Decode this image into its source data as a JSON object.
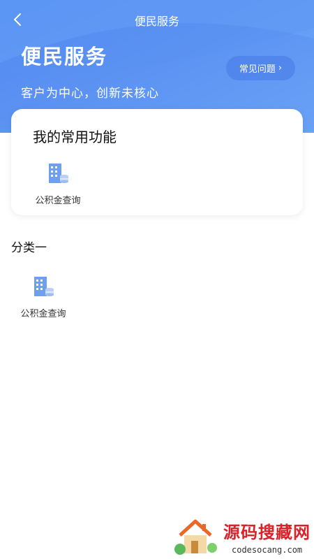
{
  "nav": {
    "title": "便民服务",
    "back_icon": "chevron-left-icon"
  },
  "hero": {
    "title": "便民服务",
    "subtitle": "客户为中心，创新未核心",
    "faq_button": {
      "label": "常见问题",
      "chevron": "›"
    }
  },
  "favorites": {
    "title": "我的常用功能",
    "items": [
      {
        "label": "公积金查询",
        "icon": "building-icon"
      }
    ]
  },
  "categories": [
    {
      "title": "分类一",
      "items": [
        {
          "label": "公积金查询",
          "icon": "building-icon"
        }
      ]
    }
  ],
  "watermark": {
    "text": "源码搜藏网",
    "url": "codesocang.com"
  },
  "colors": {
    "header_blue": "#5b93f2",
    "icon_blue": "#6fa0f0"
  }
}
